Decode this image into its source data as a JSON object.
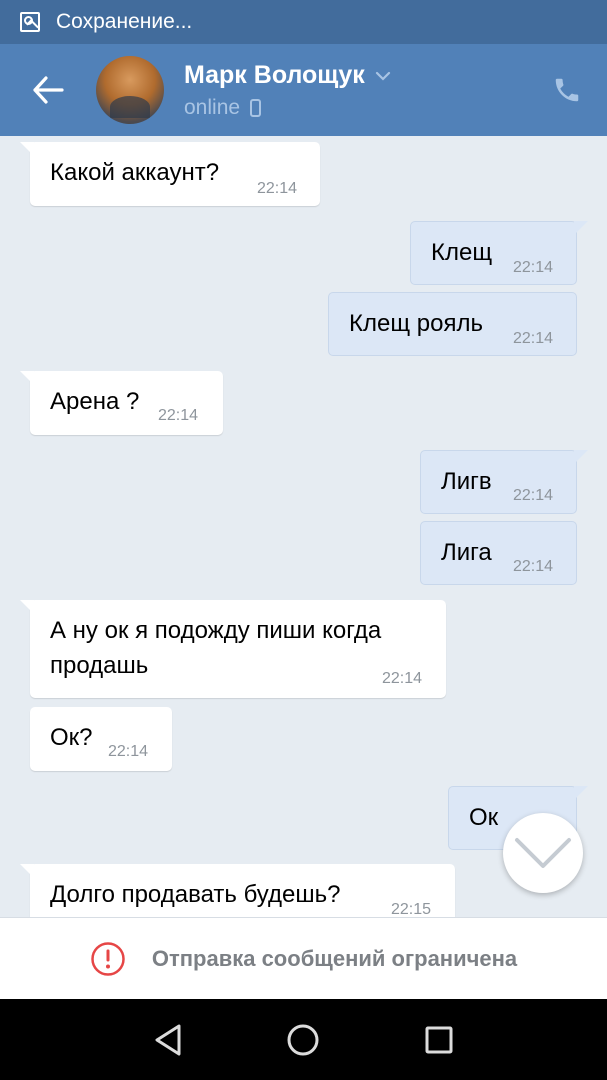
{
  "status_bar": {
    "text": "Сохранение..."
  },
  "header": {
    "contact_name": "Марк Волощук",
    "status": "online"
  },
  "messages": [
    {
      "dir": "in",
      "text": "Какой аккаунт?",
      "time": "22:14"
    },
    {
      "dir": "out",
      "text": "Клещ",
      "time": "22:14"
    },
    {
      "dir": "out",
      "text": "Клещ рояль",
      "time": "22:14"
    },
    {
      "dir": "in",
      "text": "Арена ?",
      "time": "22:14"
    },
    {
      "dir": "out",
      "text": "Лигв",
      "time": "22:14"
    },
    {
      "dir": "out",
      "text": "Лига",
      "time": "22:14"
    },
    {
      "dir": "in",
      "line1": "А ну ок я подожду пиши когда",
      "line2": "продашь",
      "time": "22:14"
    },
    {
      "dir": "in",
      "text": "Ок?",
      "time": "22:14"
    },
    {
      "dir": "out",
      "text": "Ок",
      "time": ""
    },
    {
      "dir": "in",
      "text": "Долго продавать будешь?",
      "time": "22:15"
    }
  ],
  "restriction": {
    "text": "Отправка сообщений ограничена"
  },
  "colors": {
    "header": "#5181b8",
    "status_bar": "#426c9c",
    "background": "#e6ecf2",
    "outgoing": "#dce7f6",
    "incoming": "#ffffff",
    "warning": "#e64646"
  }
}
